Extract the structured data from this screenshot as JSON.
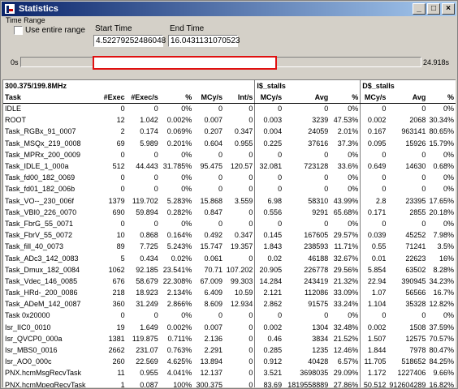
{
  "window": {
    "title": "Statistics"
  },
  "time_range": {
    "group_label": "Time Range",
    "use_entire_range_label": "Use entire range",
    "start_label": "Start Time",
    "start_value": "4.52279252486048",
    "end_label": "End Time",
    "end_value": "16.0431131070523",
    "min_label": "0s",
    "max_label": "24.918s",
    "selection_start_fraction": 0.18,
    "selection_end_fraction": 0.64
  },
  "table": {
    "summary": "300.375/199.8MHz",
    "group_headers": {
      "istalls": "I$_stalls",
      "dstalls": "D$_stalls"
    },
    "columns": [
      "Task",
      "#Exec",
      "#Exec/s",
      "%",
      "MCy/s",
      "Int/s",
      "MCy/s",
      "Avg",
      "%",
      "MCy/s",
      "Avg",
      "%"
    ],
    "rows": [
      [
        "IDLE",
        "0",
        "0",
        "0%",
        "0",
        "0",
        "0",
        "0",
        "0%",
        "0",
        "0",
        "0%"
      ],
      [
        "ROOT",
        "12",
        "1.042",
        "0.002%",
        "0.007",
        "0",
        "0.003",
        "3239",
        "47.53%",
        "0.002",
        "2068",
        "30.34%"
      ],
      [
        "Task_RGBx_91_0007",
        "2",
        "0.174",
        "0.069%",
        "0.207",
        "0.347",
        "0.004",
        "24059",
        "2.01%",
        "0.167",
        "963141",
        "80.65%"
      ],
      [
        "Task_MSQx_219_0008",
        "69",
        "5.989",
        "0.201%",
        "0.604",
        "0.955",
        "0.225",
        "37616",
        "37.3%",
        "0.095",
        "15926",
        "15.79%"
      ],
      [
        "Task_MPRx_200_0009",
        "0",
        "0",
        "0%",
        "0",
        "0",
        "0",
        "0",
        "0%",
        "0",
        "0",
        "0%"
      ],
      [
        "Task_IDLE_1_000a",
        "512",
        "44.443",
        "31.785%",
        "95.475",
        "120.57",
        "32.081",
        "723128",
        "33.6%",
        "0.649",
        "14630",
        "0.68%"
      ],
      [
        "Task_fd00_182_0069",
        "0",
        "0",
        "0%",
        "0",
        "0",
        "0",
        "0",
        "0%",
        "0",
        "0",
        "0%"
      ],
      [
        "Task_fd01_182_006b",
        "0",
        "0",
        "0%",
        "0",
        "0",
        "0",
        "0",
        "0%",
        "0",
        "0",
        "0%"
      ],
      [
        "Task_VO--_230_006f",
        "1379",
        "119.702",
        "5.283%",
        "15.868",
        "3.559",
        "6.98",
        "58310",
        "43.99%",
        "2.8",
        "23395",
        "17.65%"
      ],
      [
        "Task_VBI0_226_0070",
        "690",
        "59.894",
        "0.282%",
        "0.847",
        "0",
        "0.556",
        "9291",
        "65.68%",
        "0.171",
        "2855",
        "20.18%"
      ],
      [
        "Task_FbrG_55_0071",
        "0",
        "0",
        "0%",
        "0",
        "0",
        "0",
        "0",
        "0%",
        "0",
        "0",
        "0%"
      ],
      [
        "Task_FbrV_55_0072",
        "10",
        "0.868",
        "0.164%",
        "0.492",
        "0.347",
        "0.145",
        "167605",
        "29.57%",
        "0.039",
        "45252",
        "7.98%"
      ],
      [
        "Task_fill_40_0073",
        "89",
        "7.725",
        "5.243%",
        "15.747",
        "19.357",
        "1.843",
        "238593",
        "11.71%",
        "0.55",
        "71241",
        "3.5%"
      ],
      [
        "Task_ADc3_142_0083",
        "5",
        "0.434",
        "0.02%",
        "0.061",
        "0",
        "0.02",
        "46188",
        "32.67%",
        "0.01",
        "22623",
        "16%"
      ],
      [
        "Task_Dmux_182_0084",
        "1062",
        "92.185",
        "23.541%",
        "70.71",
        "107.202",
        "20.905",
        "226778",
        "29.56%",
        "5.854",
        "63502",
        "8.28%"
      ],
      [
        "Task_Vdec_146_0085",
        "676",
        "58.679",
        "22.308%",
        "67.009",
        "99.303",
        "14.284",
        "243419",
        "21.32%",
        "22.94",
        "390945",
        "34.23%"
      ],
      [
        "Task_HRd-_200_0086",
        "218",
        "18.923",
        "2.134%",
        "6.409",
        "10.59",
        "2.121",
        "112086",
        "33.09%",
        "1.07",
        "56566",
        "16.7%"
      ],
      [
        "Task_ADeM_142_0087",
        "360",
        "31.249",
        "2.866%",
        "8.609",
        "12.934",
        "2.862",
        "91575",
        "33.24%",
        "1.104",
        "35328",
        "12.82%"
      ],
      [
        "Task 0x20000",
        "0",
        "0",
        "0%",
        "0",
        "0",
        "0",
        "0",
        "0%",
        "0",
        "0",
        "0%"
      ],
      [
        "Isr_IIC0_0010",
        "19",
        "1.649",
        "0.002%",
        "0.007",
        "0",
        "0.002",
        "1304",
        "32.48%",
        "0.002",
        "1508",
        "37.59%"
      ],
      [
        "Isr_QVCP0_000a",
        "1381",
        "119.875",
        "0.711%",
        "2.136",
        "0",
        "0.46",
        "3834",
        "21.52%",
        "1.507",
        "12575",
        "70.57%"
      ],
      [
        "Isr_MBS0_0016",
        "2662",
        "231.07",
        "0.763%",
        "2.291",
        "0",
        "0.285",
        "1235",
        "12.46%",
        "1.844",
        "7978",
        "80.47%"
      ],
      [
        "Isr_AO0_000c",
        "260",
        "22.569",
        "4.625%",
        "13.894",
        "0",
        "0.912",
        "40428",
        "6.57%",
        "11.705",
        "518652",
        "84.25%"
      ],
      [
        "PNX.hcmMsgRecvTask",
        "11",
        "0.955",
        "4.041%",
        "12.137",
        "0",
        "3.521",
        "3698035",
        "29.09%",
        "1.172",
        "1227406",
        "9.66%"
      ],
      [
        "PNX.hcmMpegRecvTask",
        "1",
        "0.087",
        "100%",
        "300.375",
        "0",
        "83.69",
        "1819558889",
        "27.86%",
        "50.512",
        "912604289",
        "16.82%"
      ]
    ]
  }
}
